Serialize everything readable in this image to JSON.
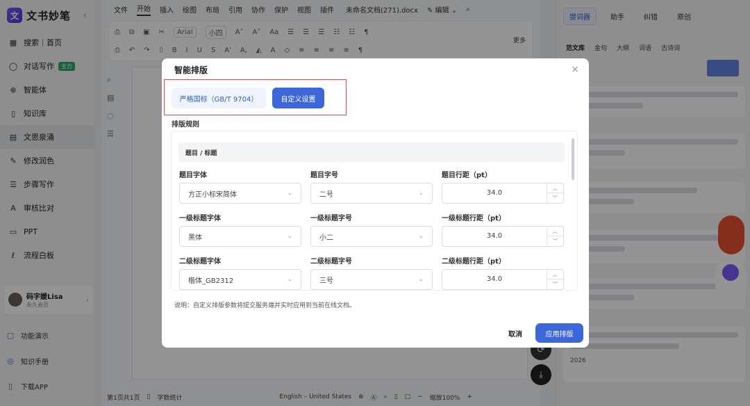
{
  "app": {
    "logo_mark": "文",
    "logo_text": "文书妙笔",
    "collapse": "‹"
  },
  "sidebar": {
    "items": [
      {
        "icon": "▦",
        "label": "搜索｜首页"
      },
      {
        "icon": "◯",
        "label": "对话写作",
        "badge": "主力"
      },
      {
        "icon": "⊕",
        "label": "智能体"
      },
      {
        "icon": "▯",
        "label": "知识库"
      },
      {
        "icon": "▤",
        "label": "文思泉涌"
      },
      {
        "icon": "✎",
        "label": "修改润色"
      },
      {
        "icon": "☰",
        "label": "步骤写作"
      },
      {
        "icon": "A",
        "label": "审核比对"
      },
      {
        "icon": "▭",
        "label": "PPT"
      },
      {
        "icon": "ℓ",
        "label": "流程白板"
      }
    ],
    "user": {
      "name": "码字媛Lisa",
      "tier": "永久会员",
      "chevron": "›"
    },
    "bottom_links": [
      {
        "icon": "▢",
        "label": "功能演示"
      },
      {
        "icon": "◎",
        "label": "知识手册"
      },
      {
        "icon": "▯",
        "label": "下载APP"
      }
    ]
  },
  "editor": {
    "menu": [
      "文件",
      "开始",
      "插入",
      "绘图",
      "布局",
      "引用",
      "协作",
      "保护",
      "视图",
      "插件"
    ],
    "active_menu": "开始",
    "doc_title": "未命名文档(271).docx",
    "edit_mode": "✎ 编辑 ⌄",
    "font_name": "Arial",
    "font_size": "小四",
    "more_label": "更多",
    "toolbar_row1": [
      "⎙",
      "⧉",
      "▣",
      "✂",
      "A˄",
      "A˅",
      "Aa",
      "☰",
      "☰",
      "☰",
      "☷",
      "☷",
      "¶"
    ],
    "toolbar_row2": [
      "⎙",
      "↶",
      "↷",
      "⌷",
      "B",
      "I",
      "U",
      "S",
      "A'",
      "A,",
      "◭",
      "A",
      "◇",
      "≡",
      "≡",
      "≡",
      "≡",
      "¶"
    ],
    "side_tools": [
      "⌕",
      "▤",
      "◌",
      "☰"
    ],
    "status": {
      "pages": "第1页共1页",
      "word_count": "字数统计",
      "language": "English – United States",
      "zoom": "缩放100%"
    }
  },
  "right_panel": {
    "tabs": [
      "提词器",
      "助手",
      "纠错",
      "原创"
    ],
    "subtabs": [
      "范文库",
      "金句",
      "大纲",
      "词语",
      "古诗词"
    ],
    "footer_date": "2026"
  },
  "modal": {
    "title": "智能排版",
    "close": "×",
    "preset_standard": "严格国标（GB/T 9704）",
    "preset_custom": "自定义设置",
    "rules_label": "排版规则",
    "section_title": "题目 / 标题",
    "rows": [
      {
        "font_label": "题目字体",
        "font_value": "方正小标宋简体",
        "size_label": "题目字号",
        "size_value": "二号",
        "spacing_label": "题目行距（pt）",
        "spacing_value": "34.0"
      },
      {
        "font_label": "一级标题字体",
        "font_value": "黑体",
        "size_label": "一级标题字号",
        "size_value": "小二",
        "spacing_label": "一级标题行距（pt）",
        "spacing_value": "34.0"
      },
      {
        "font_label": "二级标题字体",
        "font_value": "楷体_GB2312",
        "size_label": "二级标题字号",
        "size_value": "三号",
        "spacing_label": "二级标题行距（pt）",
        "spacing_value": "34.0"
      }
    ],
    "note": "说明：自定义排版参数将提交服务端并实时应用到当前在线文档。",
    "cancel": "取消",
    "apply": "应用排版"
  },
  "colors": {
    "primary": "#3d67d8",
    "highlight_frame": "#e04747",
    "badge_green": "#33a86a"
  }
}
